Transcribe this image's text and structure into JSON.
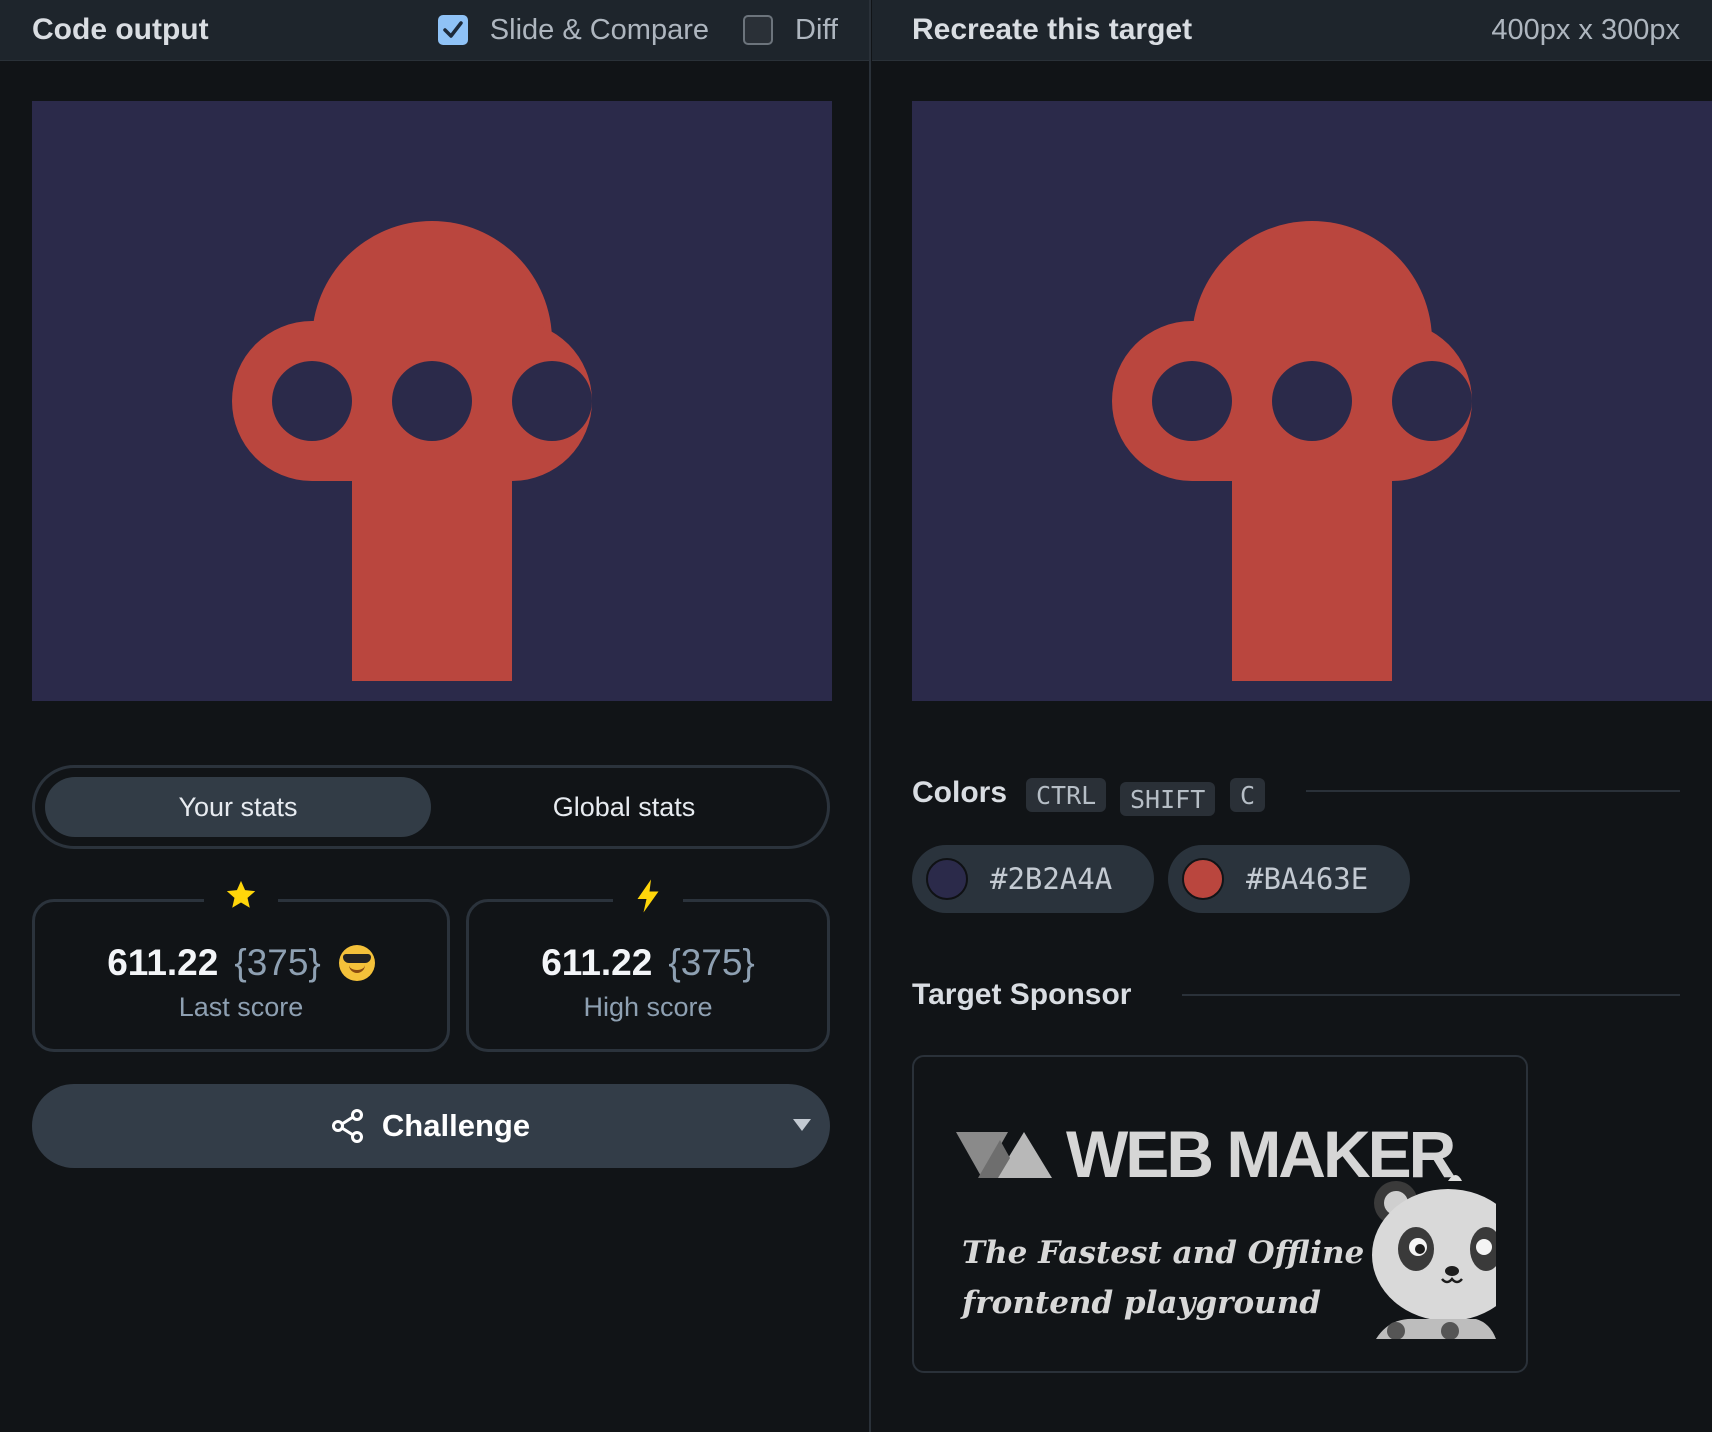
{
  "output_panel": {
    "title": "Code output",
    "slide_compare": {
      "label": "Slide & Compare",
      "checked": true
    },
    "diff": {
      "label": "Diff",
      "checked": false
    }
  },
  "target_panel": {
    "title": "Recreate this target",
    "dimensions": "400px x 300px"
  },
  "canvas": {
    "background": "#2B2A4A",
    "shape_color": "#BA463E",
    "shape": "keyhole-like crest with three circular holes over a rectangular stem"
  },
  "stats": {
    "tabs": [
      {
        "label": "Your stats",
        "active": true
      },
      {
        "label": "Global stats",
        "active": false
      }
    ],
    "last": {
      "icon": "star-icon",
      "value": "611.22",
      "detail": "{375}",
      "label": "Last score",
      "emoji": "sunglasses-emoji"
    },
    "high": {
      "icon": "lightning-icon",
      "value": "611.22",
      "detail": "{375}",
      "label": "High score"
    }
  },
  "challenge": {
    "label": "Challenge",
    "icon": "share-icon"
  },
  "colors": {
    "title": "Colors",
    "shortcut": [
      "CTRL",
      "SHIFT",
      "C"
    ],
    "swatches": [
      {
        "hex": "#2B2A4A"
      },
      {
        "hex": "#BA463E"
      }
    ]
  },
  "sponsor": {
    "title": "Target Sponsor",
    "brand": "WEB MAKER",
    "tagline_1": "The Fastest and Offline",
    "tagline_2": "frontend playground"
  }
}
